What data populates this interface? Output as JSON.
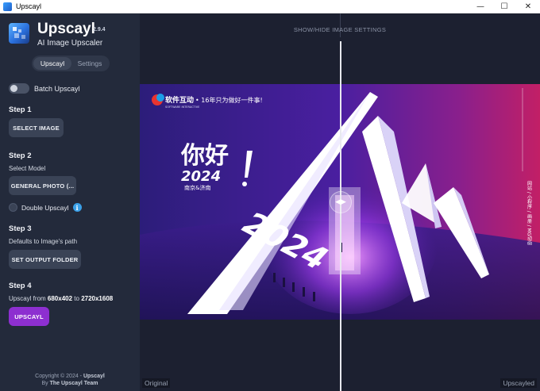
{
  "window": {
    "title": "Upscayl",
    "controls": {
      "minimize": "—",
      "maximize": "☐",
      "close": "✕"
    }
  },
  "sidebar": {
    "brand": {
      "name": "Upscayl",
      "version": "2.9.4",
      "subtitle": "AI Image Upscaler"
    },
    "tabs": [
      {
        "label": "Upscayl",
        "active": true
      },
      {
        "label": "Settings",
        "active": false
      }
    ],
    "batch_toggle": {
      "label": "Batch Upscayl",
      "on": false
    },
    "step1": {
      "title": "Step 1",
      "button": "SELECT IMAGE"
    },
    "step2": {
      "title": "Step 2",
      "select_label": "Select Model",
      "model_button": "GENERAL PHOTO (...",
      "double_upscayl": {
        "label": "Double Upscayl",
        "checked": false,
        "info": "i"
      }
    },
    "step3": {
      "title": "Step 3",
      "note": "Defaults to Image's path",
      "button": "SET OUTPUT FOLDER"
    },
    "step4": {
      "title": "Step 4",
      "note_prefix": "Upscayl from ",
      "from_size": "680x402",
      "note_mid": " to ",
      "to_size": "2720x1608",
      "button": "UPSCAYL"
    },
    "footer": {
      "copyright_prefix": "Copyright © 2024 - ",
      "brand": "Upscayl",
      "by_prefix": "By ",
      "team": "The Upscayl Team"
    }
  },
  "main": {
    "toggle_settings_label": "SHOW/HIDE IMAGE SETTINGS",
    "left_tag": "Original",
    "right_tag": "Upscayled",
    "handle_icon": "◀▶",
    "poster": {
      "logo_text": "软件互动",
      "logo_sub": "SOFTWARE INTERACTIVE",
      "slogan": "• 16年只为做好一件事!",
      "headline": "你好",
      "year": "2024",
      "cities": "南京&济南",
      "big_year": "2024",
      "side_text": "网站 / 小程序 / 画册 / MG动画"
    }
  },
  "colors": {
    "sidebar_bg": "#232a3b",
    "main_bg": "#1c2030",
    "button_bg": "#3a4356",
    "primary": "#8d2fd0",
    "info": "#3aa0e8"
  }
}
